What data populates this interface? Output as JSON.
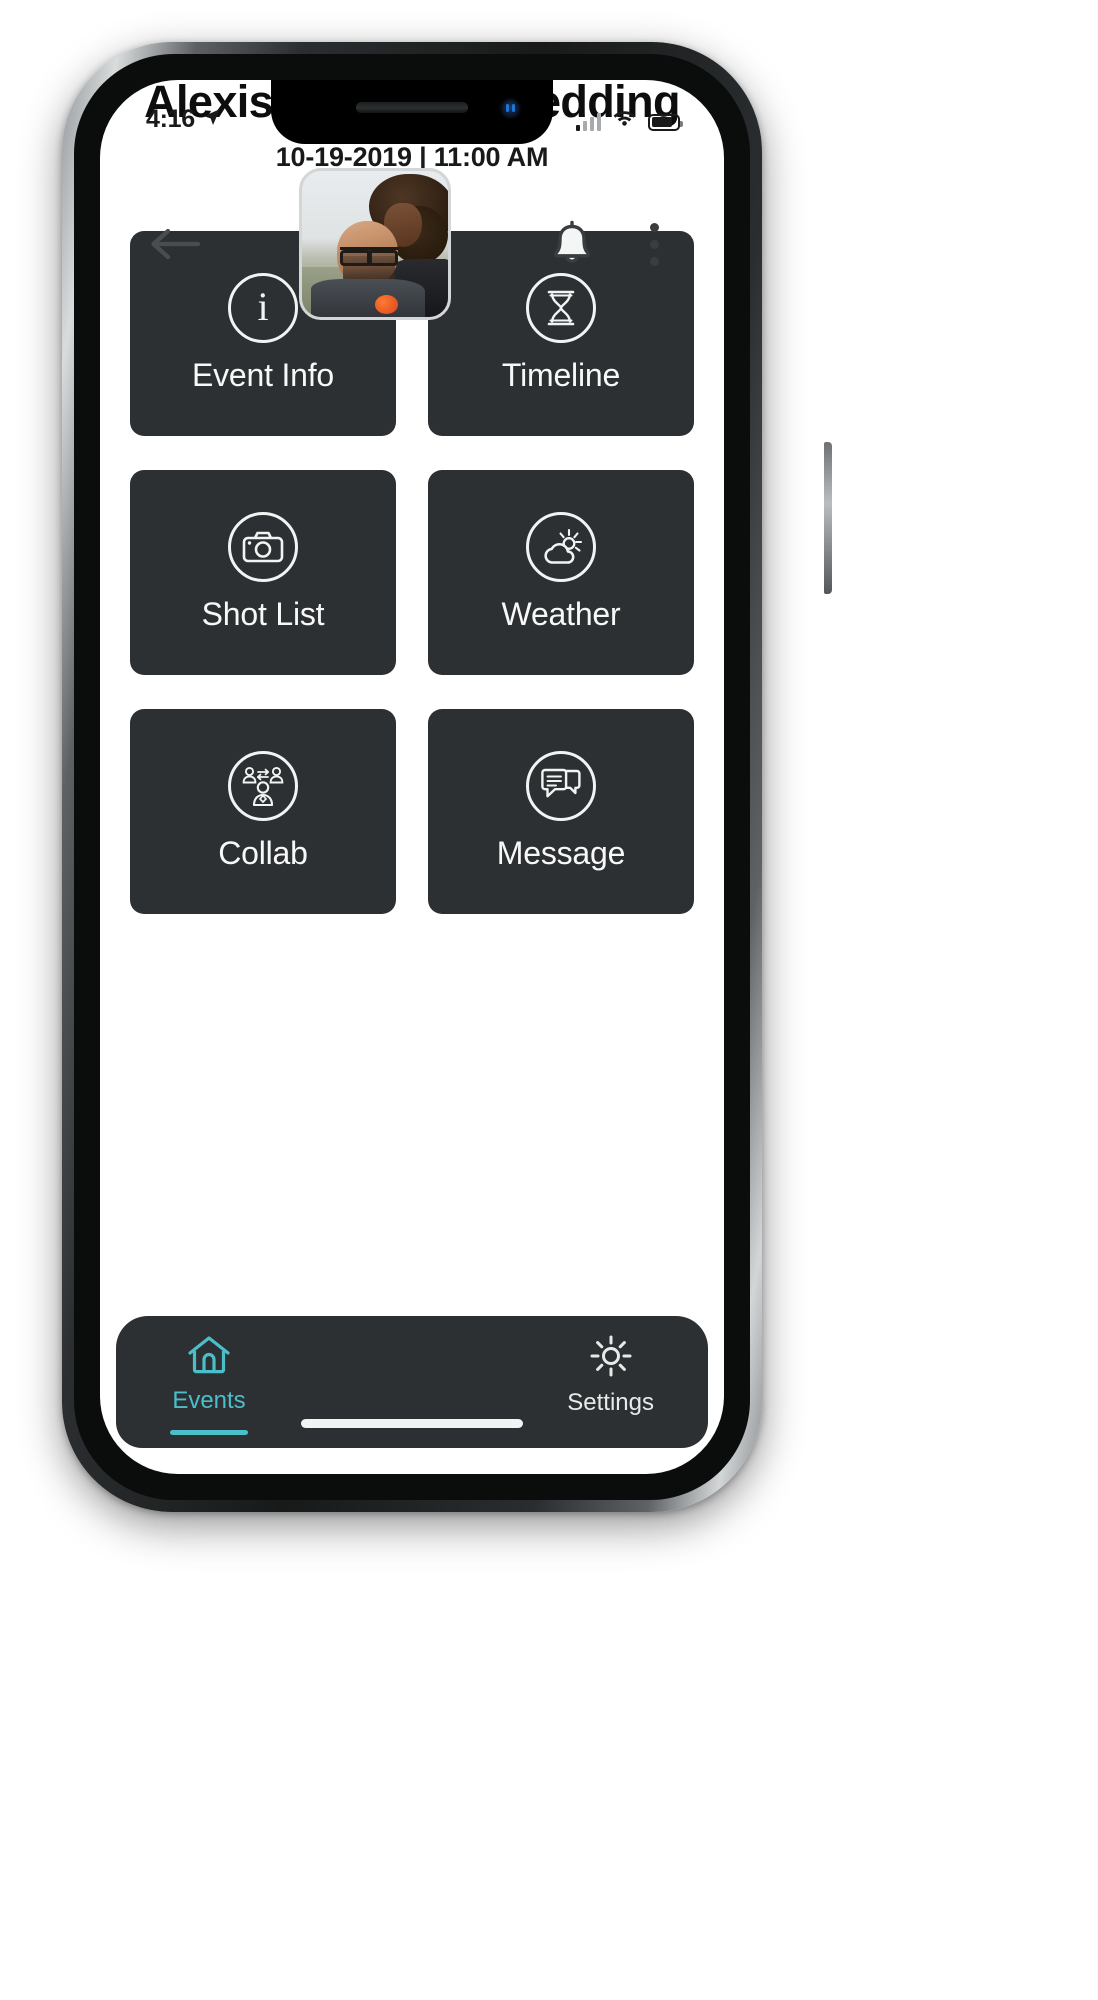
{
  "status_bar": {
    "time": "4:16",
    "location_icon": "location-arrow-icon",
    "signal_icon": "cellular-signal-icon",
    "wifi_icon": "wifi-icon",
    "battery_icon": "battery-icon"
  },
  "header": {
    "back_icon": "arrow-left-icon",
    "avatar_name": "event-cover-photo",
    "bell_icon": "bell-icon",
    "menu_icon": "more-vertical-icon"
  },
  "event": {
    "title": "Alexis & David’s Wedding",
    "datetime": "10-19-2019 | 11:00 AM"
  },
  "tiles": [
    {
      "label": "Event Info",
      "icon": "info-circle-icon"
    },
    {
      "label": "Timeline",
      "icon": "hourglass-icon"
    },
    {
      "label": "Shot List",
      "icon": "camera-icon"
    },
    {
      "label": "Weather",
      "icon": "sun-cloud-icon"
    },
    {
      "label": "Collab",
      "icon": "people-exchange-icon"
    },
    {
      "label": "Message",
      "icon": "chat-bubbles-icon"
    }
  ],
  "bottom_nav": {
    "items": [
      {
        "label": "Events",
        "icon": "home-icon",
        "active": true
      },
      {
        "label": "Settings",
        "icon": "gear-icon",
        "active": false
      }
    ],
    "active_color": "#4bbfc9",
    "inactive_color": "#e8eaea"
  },
  "colors": {
    "tile_background": "#2d3033",
    "screen_background": "#ffffff",
    "accent": "#4bbfc9"
  }
}
